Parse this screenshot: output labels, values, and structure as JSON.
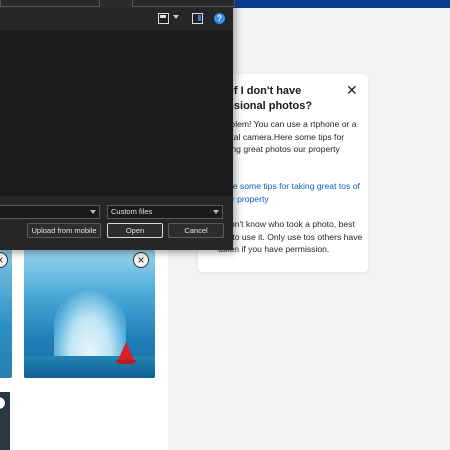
{
  "tips_card": {
    "title": "at if I don't have fessional photos?",
    "body": "problem! You can use a rtphone or a digital camera.Here some tips for taking great photos our property",
    "link": "e are some tips for taking great tos of your property",
    "note": "u don't know who took a photo, best not to use it. Only use tos others have taken if you have permission."
  },
  "dialog": {
    "filetype": "Custom files",
    "buttons": {
      "upload_mobile": "Upload from mobile",
      "open": "Open",
      "cancel": "Cancel"
    },
    "help_glyph": "?"
  },
  "photos": {
    "remove_glyph": "×"
  },
  "colors": {
    "dialog_bg": "#1f1f1f",
    "link": "#0c5fbf",
    "top_bar": "#0a3d8f"
  },
  "icons": [
    "view-icon",
    "chevron-down-icon",
    "preview-pane-icon",
    "help-icon",
    "close-icon",
    "remove-icon"
  ]
}
